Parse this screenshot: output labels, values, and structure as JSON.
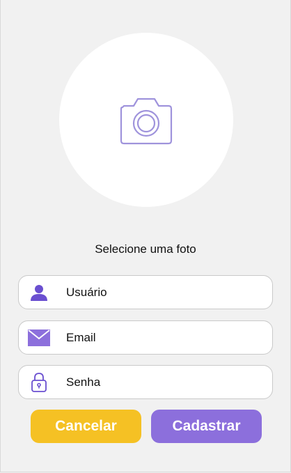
{
  "photo": {
    "icon": "camera-icon",
    "label": "Selecione uma foto"
  },
  "form": {
    "username": {
      "icon": "user-icon",
      "placeholder": "Usuário"
    },
    "email": {
      "icon": "envelope-icon",
      "placeholder": "Email"
    },
    "password": {
      "icon": "lock-icon",
      "placeholder": "Senha"
    }
  },
  "buttons": {
    "cancel_label": "Cancelar",
    "submit_label": "Cadastrar"
  },
  "colors": {
    "background": "#f1f1f1",
    "accent_purple": "#8c6fdc",
    "accent_yellow": "#f5c124",
    "icon_purple": "#6a4fd0"
  }
}
